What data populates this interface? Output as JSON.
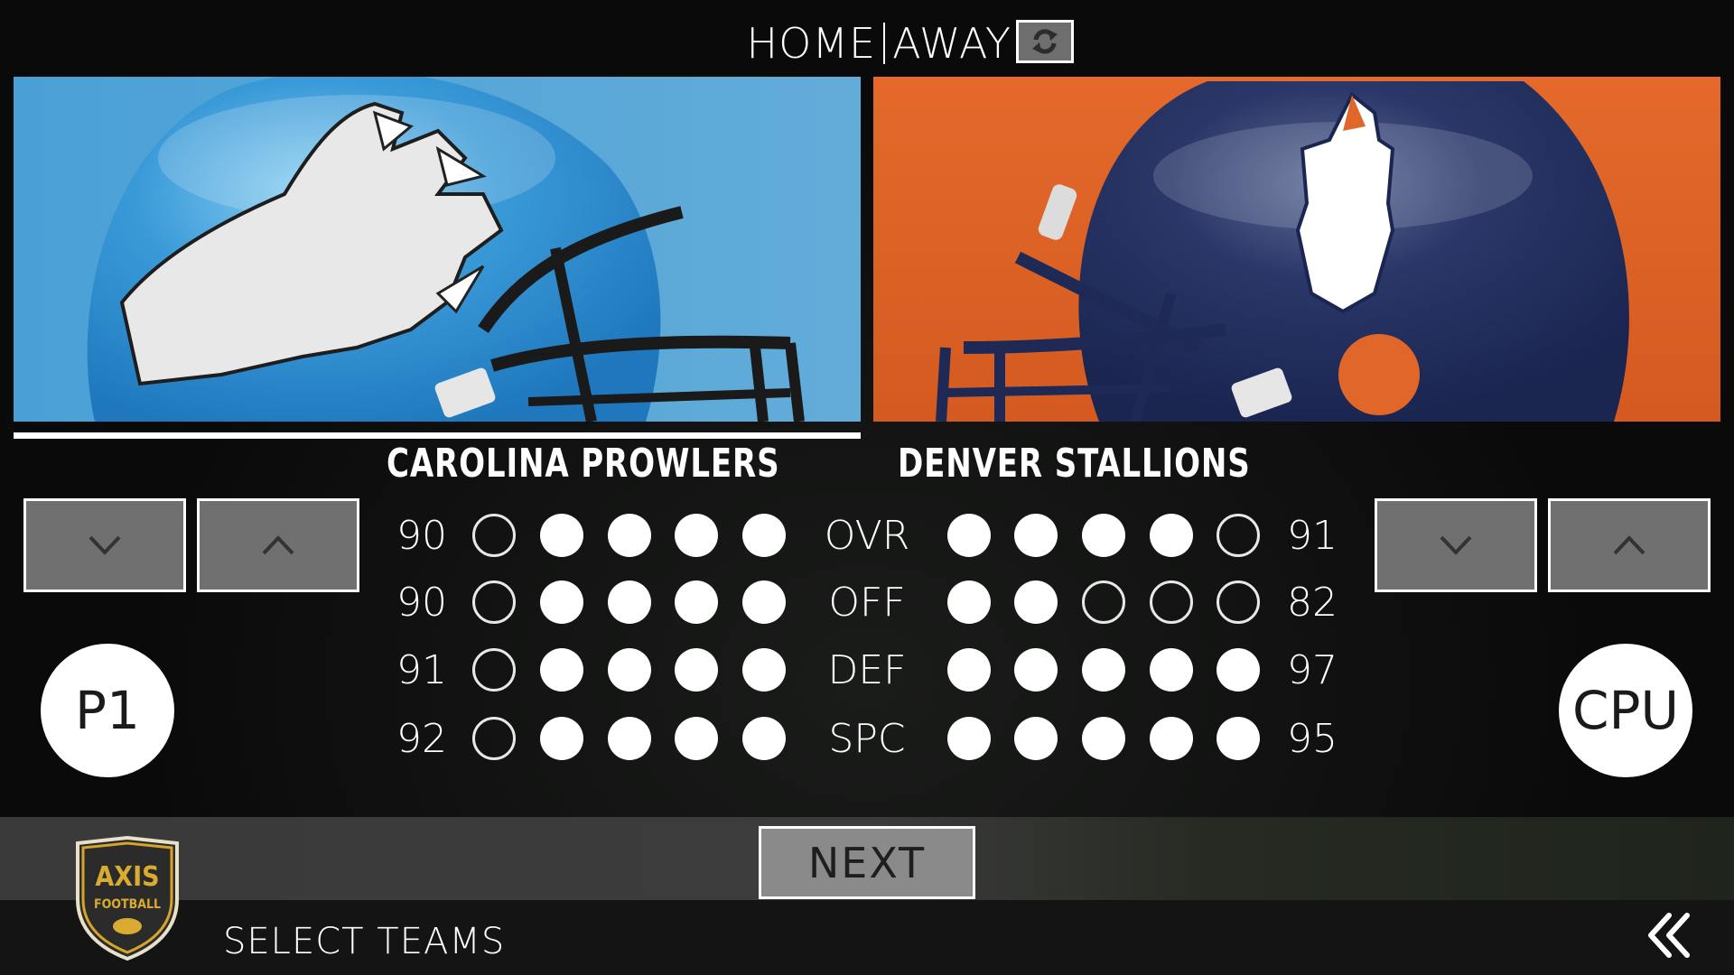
{
  "header": {
    "home_label": "HOME",
    "away_label": "AWAY",
    "swap_icon": "swap-refresh-icon"
  },
  "teams": {
    "home": {
      "name": "CAROLINA PROWLERS",
      "selected": true,
      "controller": "P1",
      "panel_color": "#5aaad8",
      "helmet_color": "#3e99d6",
      "logo": "claw-logo",
      "ratings": [
        {
          "label": "OVR",
          "value": "90",
          "stars_filled": 4,
          "stars_total": 5
        },
        {
          "label": "OFF",
          "value": "90",
          "stars_filled": 4,
          "stars_total": 5
        },
        {
          "label": "DEF",
          "value": "91",
          "stars_filled": 4,
          "stars_total": 5
        },
        {
          "label": "SPC",
          "value": "92",
          "stars_filled": 4,
          "stars_total": 5
        }
      ]
    },
    "away": {
      "name": "DENVER STALLIONS",
      "selected": false,
      "controller": "CPU",
      "panel_color": "#e0662a",
      "helmet_color": "#1e2a55",
      "logo": "horse-logo",
      "ratings": [
        {
          "label": "OVR",
          "value": "91",
          "stars_filled": 4,
          "stars_total": 5
        },
        {
          "label": "OFF",
          "value": "82",
          "stars_filled": 2,
          "stars_total": 5
        },
        {
          "label": "DEF",
          "value": "97",
          "stars_filled": 5,
          "stars_total": 5
        },
        {
          "label": "SPC",
          "value": "95",
          "stars_filled": 5,
          "stars_total": 5
        }
      ]
    }
  },
  "rating_labels": [
    "OVR",
    "OFF",
    "DEF",
    "SPC"
  ],
  "buttons": {
    "prev_team_icon": "chevron-down-icon",
    "next_team_icon": "chevron-up-icon",
    "next_label": "NEXT"
  },
  "footer": {
    "logo_line1": "AXIS",
    "logo_line2": "FOOTBALL",
    "screen_title": "SELECT TEAMS",
    "back_icon": "double-chevron-left-icon"
  }
}
